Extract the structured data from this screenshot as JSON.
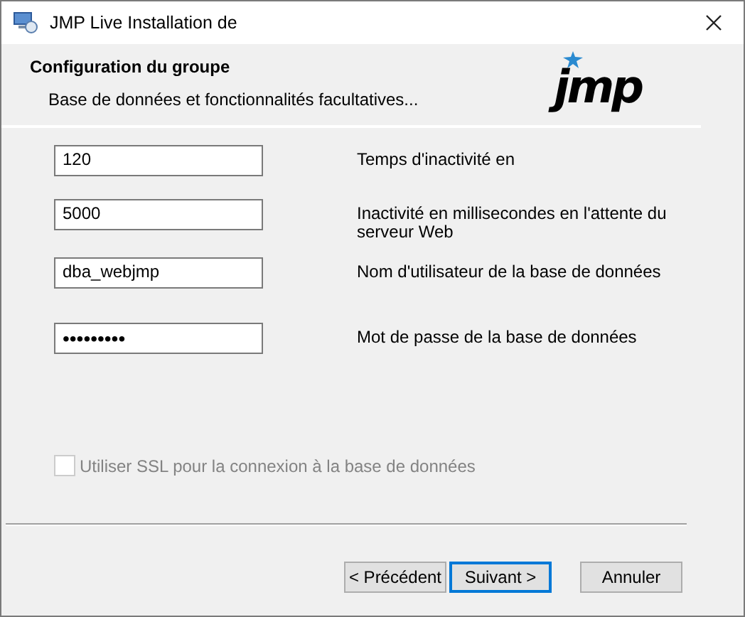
{
  "window": {
    "title": "JMP Live Installation de"
  },
  "header": {
    "title": "Configuration du groupe",
    "subtitle": "Base de données et fonctionnalités facultatives...",
    "logo": "jmp"
  },
  "fields": [
    {
      "value": "120",
      "label": "Temps d'inactivité en"
    },
    {
      "value": "5000",
      "label": "Inactivité en millisecondes en l'attente du serveur Web"
    },
    {
      "value": "dba_webjmp",
      "label": "Nom d'utilisateur de la base de données"
    },
    {
      "value": "•••••••••",
      "label": "Mot de passe de la base de données"
    }
  ],
  "checkbox": {
    "label": "Utiliser SSL pour la connexion à la base de données",
    "checked": false,
    "disabled": true
  },
  "buttons": [
    {
      "label": "< Précédent",
      "default": false
    },
    {
      "label": "Suivant >",
      "default": true
    },
    {
      "label": "Annuler",
      "default": false
    }
  ]
}
